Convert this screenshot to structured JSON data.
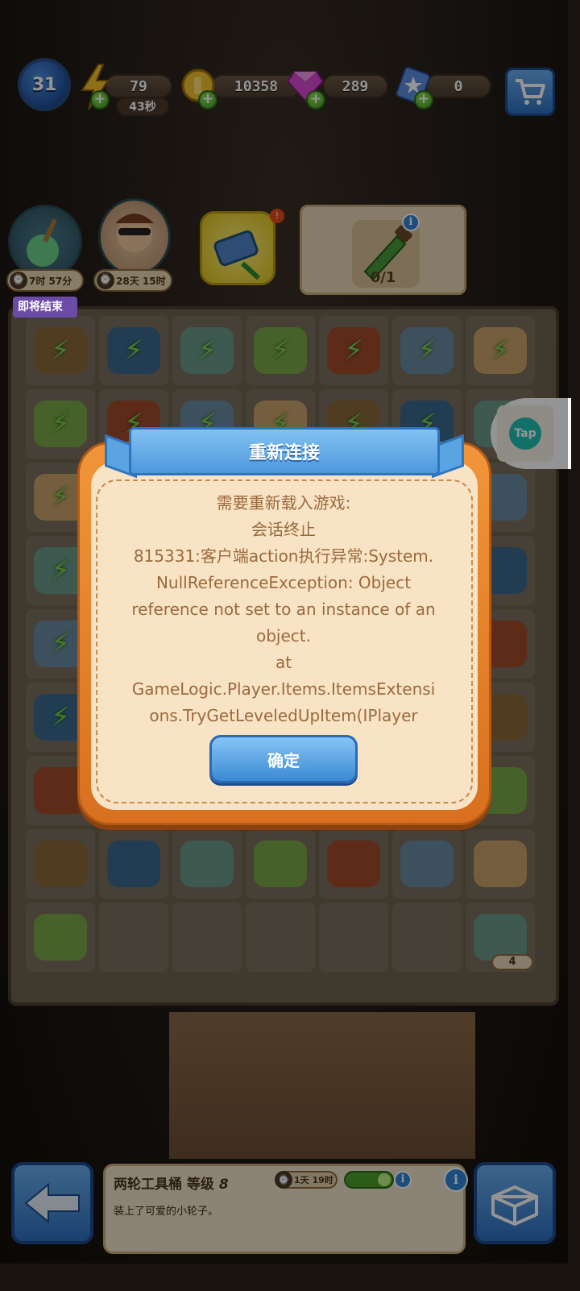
{
  "hud": {
    "level": "31",
    "energy": "79",
    "energy_timer": "43秒",
    "coins": "10358",
    "gems": "289",
    "stars": "0"
  },
  "quests": {
    "quest1_timer": "7时 57分",
    "quest2_timer": "28天 15时",
    "order_progress": "0/1",
    "ending_soon_label": "即将结束"
  },
  "board": {
    "item_count_badge": "4"
  },
  "float_button": {
    "label": "Tap"
  },
  "dialog": {
    "title": "重新连接",
    "lines": [
      "需要重新载入游戏:",
      "会话终止",
      "815331:客户端action执行异常:System.",
      "NullReferenceException: Object",
      "reference not set to an instance of an",
      "object.",
      "at",
      "GameLogic.Player.Items.ItemsExtensi",
      "ons.TryGetLeveledUpItem(IPlayer"
    ],
    "confirm_label": "确定"
  },
  "item_info": {
    "title": "两轮工具桶 等级",
    "level": "8",
    "timer": "1天 19时",
    "description": "装上了可爱的小轮子。"
  }
}
